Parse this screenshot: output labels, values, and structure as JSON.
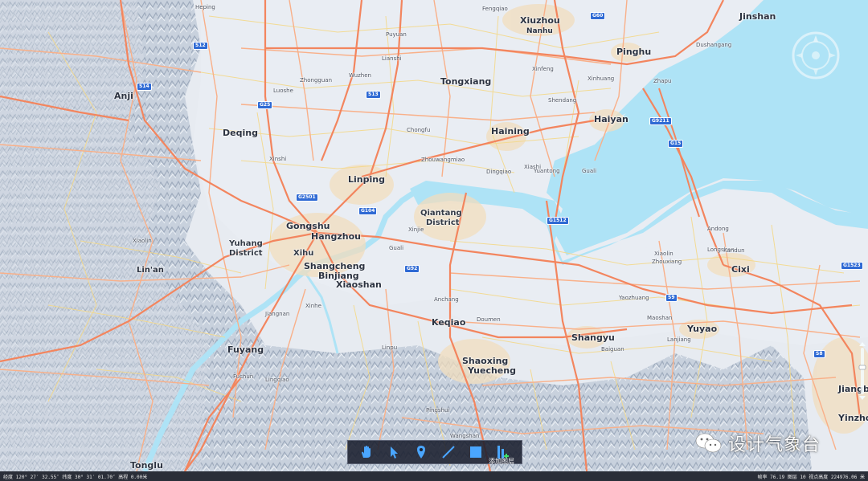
{
  "map": {
    "colors": {
      "sea": "#aee3f6",
      "terrain": "#c4cedb",
      "highway": "#f3855e",
      "road": "#f9b089",
      "minor_road": "#f4d98a",
      "urban": "#f1ddbe",
      "shield": "#2f6ad4"
    },
    "cities": [
      {
        "name": "Xiuzhou"
      },
      {
        "name": "Nanhu"
      },
      {
        "name": "Jinshan"
      },
      {
        "name": "Pinghu"
      },
      {
        "name": "Tongxiang"
      },
      {
        "name": "Haining"
      },
      {
        "name": "Haiyan"
      },
      {
        "name": "Anji"
      },
      {
        "name": "Deqing"
      },
      {
        "name": "Linping"
      },
      {
        "name": "Gongshu"
      },
      {
        "name": "Hangzhou"
      },
      {
        "name": "Shangcheng"
      },
      {
        "name": "Binjiang"
      },
      {
        "name": "Xiaoshan"
      },
      {
        "name": "Lin'an"
      },
      {
        "name": "Keqiao"
      },
      {
        "name": "Shaoxing"
      },
      {
        "name": "Yuecheng"
      },
      {
        "name": "Shangyu"
      },
      {
        "name": "Yuyao"
      },
      {
        "name": "Cixi"
      },
      {
        "name": "Fuyang"
      },
      {
        "name": "Tonglu"
      },
      {
        "name": "Jiangbei"
      },
      {
        "name": "Yinzhou"
      }
    ],
    "districts": [
      {
        "name": "Yuhang"
      },
      {
        "name": "District"
      },
      {
        "name": "Xihu"
      },
      {
        "name": "Qiantang"
      },
      {
        "name": "District"
      }
    ],
    "towns": [
      {
        "name": "Heping"
      },
      {
        "name": "Xinshi"
      },
      {
        "name": "Lianshi"
      },
      {
        "name": "Wuzhen"
      },
      {
        "name": "Puyuan"
      },
      {
        "name": "Xinfeng"
      },
      {
        "name": "Fengqiao"
      },
      {
        "name": "Zhapu"
      },
      {
        "name": "Dushangang"
      },
      {
        "name": "Xinhuang"
      },
      {
        "name": "Shendang"
      },
      {
        "name": "Zhongguan"
      },
      {
        "name": "Luoshe"
      },
      {
        "name": "Xiashi"
      },
      {
        "name": "Chongfu"
      },
      {
        "name": "Zhouwangmiao"
      },
      {
        "name": "Dingqiao"
      },
      {
        "name": "Yuantong"
      },
      {
        "name": "Xiaolin"
      },
      {
        "name": "Guali"
      },
      {
        "name": "Xinjie"
      },
      {
        "name": "Zhouxiang"
      },
      {
        "name": "Longshan"
      },
      {
        "name": "Anchang"
      },
      {
        "name": "Doumen"
      },
      {
        "name": "Pingshui"
      },
      {
        "name": "Wangshan"
      },
      {
        "name": "Guali"
      },
      {
        "name": "Jiangnan"
      },
      {
        "name": "Fuchun"
      },
      {
        "name": "Lingqiao"
      },
      {
        "name": "Xinhe"
      },
      {
        "name": "Linpu"
      },
      {
        "name": "Yaozhuang"
      },
      {
        "name": "Baiguan"
      },
      {
        "name": "Andong"
      },
      {
        "name": "Kandun"
      },
      {
        "name": "Xiaolin"
      },
      {
        "name": "Lanjiang"
      },
      {
        "name": "Maoshan"
      }
    ],
    "shields": [
      {
        "ref": "G60"
      },
      {
        "ref": "G92"
      },
      {
        "ref": "G15"
      },
      {
        "ref": "G25"
      },
      {
        "ref": "S12"
      },
      {
        "ref": "S13"
      },
      {
        "ref": "S14"
      },
      {
        "ref": "G2501"
      },
      {
        "ref": "G1512"
      },
      {
        "ref": "G9211"
      },
      {
        "ref": "S9"
      },
      {
        "ref": "G1523"
      },
      {
        "ref": "S8"
      },
      {
        "ref": "G104"
      }
    ]
  },
  "toolbar": {
    "pan_tool": "hand-icon",
    "select_tool": "arrow-cursor-icon",
    "placemark_tool": "pin-icon",
    "line_tool": "line-icon",
    "polygon_tool": "rectangle-icon",
    "add_layer_tool": "add-layer-icon",
    "add_layer_label": "添加图层"
  },
  "statusbar": {
    "left": "经度 120° 27′ 32.55″ 纬度 30° 31′ 01.70″ 高程 0.00米",
    "right": "帧率 76.19   图层 10   视点高度 224976.06 米"
  },
  "watermark": {
    "text": "设计气象台",
    "icon": "wechat-icon"
  }
}
